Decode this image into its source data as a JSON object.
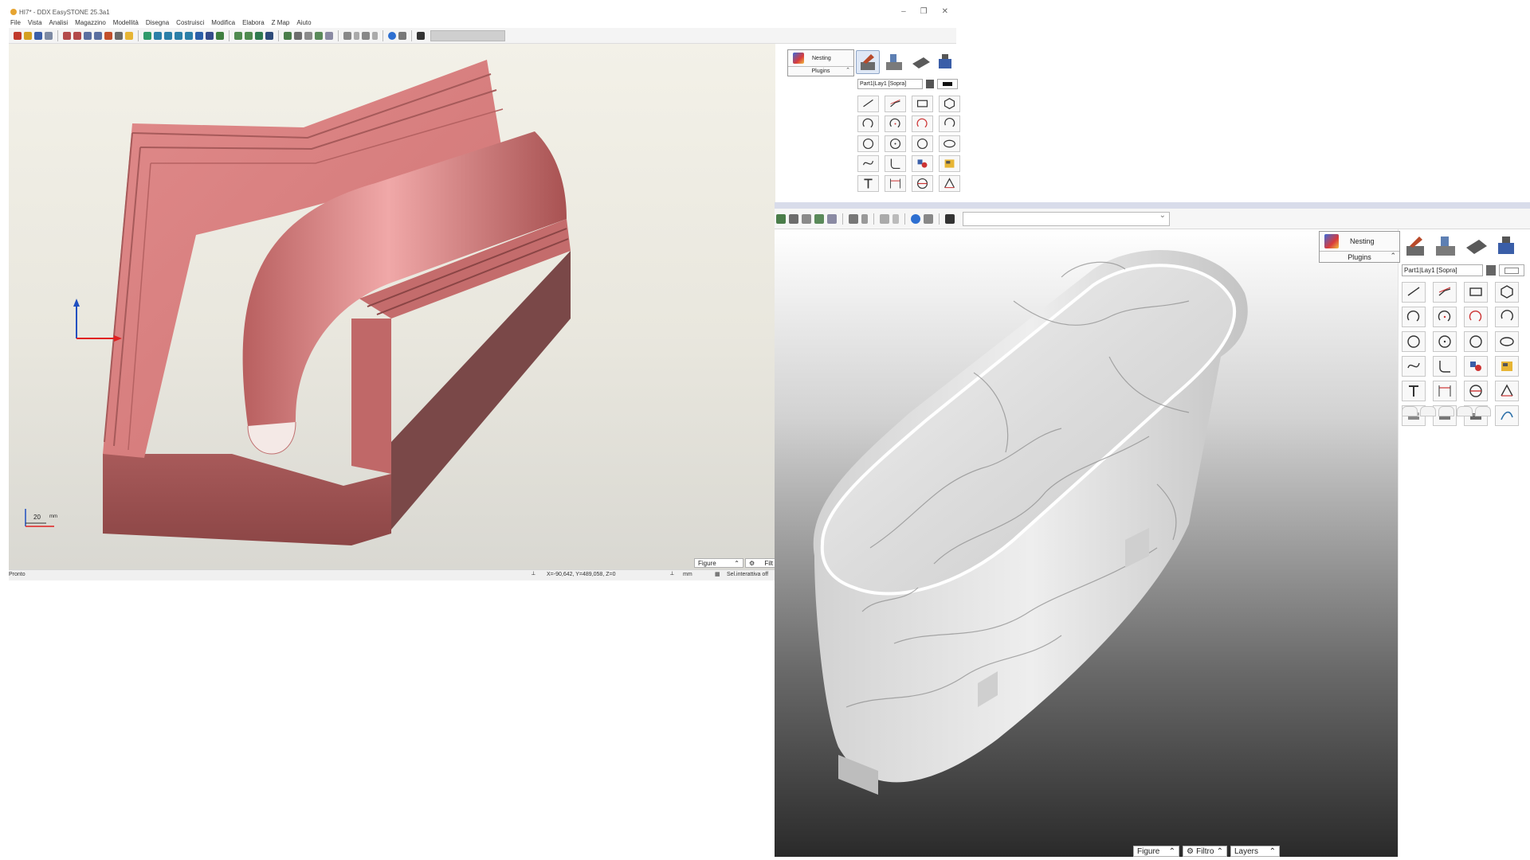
{
  "window_a": {
    "title": "HI7* - DDX EasySTONE 25.3a1",
    "menu": [
      "File",
      "Vista",
      "Analisi",
      "Magazzino",
      "Modellità",
      "Disegna",
      "Costruisci",
      "Modifica",
      "Elabora",
      "Z Map",
      "Aiuto"
    ],
    "sidebar": {
      "nesting_label": "Nesting",
      "plugins_label": "Plugins",
      "layer_combo": "Part1|Lay1 [Sopra]"
    },
    "axis": {
      "scale": "20",
      "unit": "mm"
    },
    "footer": {
      "figure_label": "Figure",
      "filter_label": "Filt"
    },
    "status": {
      "ready": "Pronto",
      "coords": "X=-90,642, Y=489,058, Z=0",
      "unit": "mm",
      "selection": "Sel.interattiva off"
    }
  },
  "window_b": {
    "sidebar": {
      "nesting_label": "Nesting",
      "plugins_label": "Plugins",
      "layer_combo": "Part1|Lay1 [Sopra]"
    },
    "footer": {
      "figure_label": "Figure",
      "filter_label": "Filtro",
      "layers_label": "Layers"
    }
  },
  "colors": {
    "model_pink": "#d98080",
    "model_pink_dark": "#7a4848",
    "axis_red": "#e02020",
    "axis_blue": "#2050c0",
    "marble": "#e6e6e6"
  }
}
